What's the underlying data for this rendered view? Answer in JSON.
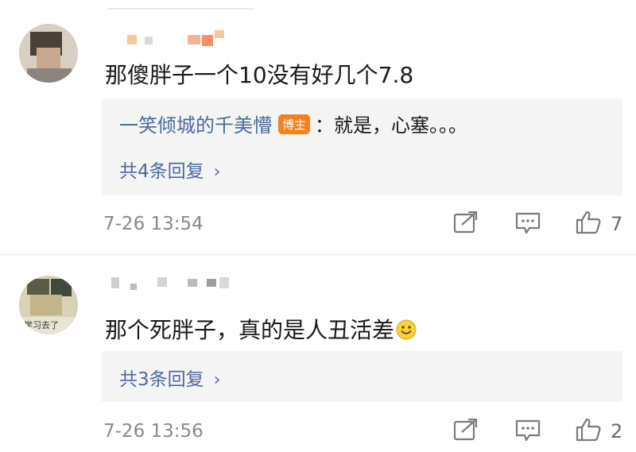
{
  "comments": [
    {
      "text": "那傻胖子一个10没有好几个7.8",
      "reply": {
        "author": "一笑倾城的千美懵",
        "badge": "博主",
        "text": "：就是，心塞。。。"
      },
      "more_replies": "共4条回复",
      "time": "7-26 13:54",
      "likes": "7"
    },
    {
      "text": "那个死胖子，真的是人丑活差",
      "avatar_text": "学习去了",
      "more_replies": "共3条回复",
      "time": "7-26 13:56",
      "likes": "2"
    }
  ],
  "icons": [
    "share-icon",
    "comment-icon",
    "like-icon",
    "chevron-right-icon",
    "smiley-emoji"
  ],
  "colors": {
    "link": "#4b6a9f",
    "badge": "#f7801a",
    "meta": "#8a8a8a",
    "reply_bg": "#f4f4f4"
  }
}
